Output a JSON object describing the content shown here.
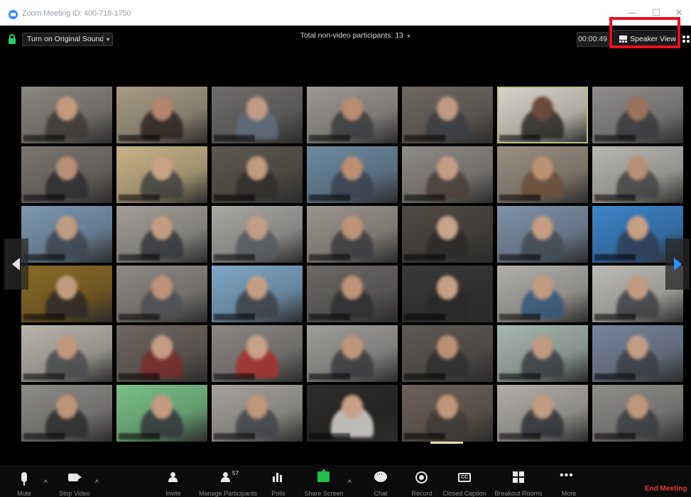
{
  "window": {
    "title": "Zoom Meeting ID: 400-718-1750",
    "min_glyph": "—",
    "max_glyph": "☐",
    "close_glyph": "✕"
  },
  "topbar": {
    "lock_icon": "lock-icon",
    "sound_button": "Turn on Original Sound",
    "sound_caret": "▾",
    "participants_note": "Total non-video participants: 13",
    "participants_caret": "▾",
    "timer": "00:00:49",
    "speaker_view": "Speaker View"
  },
  "colors": {
    "highlight": "#e8101e",
    "active_speaker_border": "#b8c27a",
    "share_green": "#1fbf4a",
    "end_meeting_red": "#e8363b",
    "next_page_arrow": "#2d8cff"
  },
  "gallery": {
    "columns": 7,
    "rows": 6,
    "active_tile": 5,
    "tiles": [
      {
        "bg": "#8a8680",
        "face": "#c49a7e",
        "shirt": "#3d3a37"
      },
      {
        "bg": "#a89b86",
        "face": "#b5856b",
        "shirt": "#2c2522"
      },
      {
        "bg": "#6e6d6b",
        "face": "#c19a84",
        "shirt": "#5f6e7d"
      },
      {
        "bg": "#9c9894",
        "face": "#b88d72",
        "shirt": "#3c3d40"
      },
      {
        "bg": "#6f6862",
        "face": "#c09982",
        "shirt": "#3b3e44"
      },
      {
        "bg": "#d9d4c8",
        "face": "#6a4a3a",
        "shirt": "#2c2a28"
      },
      {
        "bg": "#8f8d8b",
        "face": "#9b735c",
        "shirt": "#3a3a3d"
      },
      {
        "bg": "#7b7570",
        "face": "#b98f75",
        "shirt": "#2e2e30"
      },
      {
        "bg": "#c7b389",
        "face": "#c8a285",
        "shirt": "#40413f"
      },
      {
        "bg": "#5d5850",
        "face": "#c09a7e",
        "shirt": "#312f2d"
      },
      {
        "bg": "#6f8aa0",
        "face": "#b98e72",
        "shirt": "#3a4250"
      },
      {
        "bg": "#8e8a87",
        "face": "#c49c84",
        "shirt": "#4a3f3a"
      },
      {
        "bg": "#9a8f80",
        "face": "#bb9274",
        "shirt": "#6b4f3b"
      },
      {
        "bg": "#b9b7b2",
        "face": "#b88e74",
        "shirt": "#444446"
      },
      {
        "bg": "#7d97b0",
        "face": "#c09b80",
        "shirt": "#3f4552"
      },
      {
        "bg": "#a29f9a",
        "face": "#c39b80",
        "shirt": "#36383c"
      },
      {
        "bg": "#a9a7a4",
        "face": "#c29d85",
        "shirt": "#55595f"
      },
      {
        "bg": "#9b958e",
        "face": "#bd9375",
        "shirt": "#3a3b3e"
      },
      {
        "bg": "#4f4a44",
        "face": "#c6a489",
        "shirt": "#2c2b2a"
      },
      {
        "bg": "#7f92a8",
        "face": "#c49d82",
        "shirt": "#434a55"
      },
      {
        "bg": "#3f84c9",
        "face": "#c99f84",
        "shirt": "#2f3e55"
      },
      {
        "bg": "#8a6a28",
        "face": "#c19a7d",
        "shirt": "#2d2a26"
      },
      {
        "bg": "#8e8a86",
        "face": "#bd9278",
        "shirt": "#4d4f52"
      },
      {
        "bg": "#7fa7c6",
        "face": "#c49e84",
        "shirt": "#3e4145"
      },
      {
        "bg": "#6b6866",
        "face": "#bd9478",
        "shirt": "#2f3033"
      },
      {
        "bg": "#3b3a38",
        "face": "#c5a084",
        "shirt": "#2a2a2a"
      },
      {
        "bg": "#b1afab",
        "face": "#c09a7f",
        "shirt": "#34567a"
      },
      {
        "bg": "#bdbcb8",
        "face": "#c29b81",
        "shirt": "#3f4043"
      },
      {
        "bg": "#b9b5ad",
        "face": "#bf977b",
        "shirt": "#484a4d"
      },
      {
        "bg": "#6e6661",
        "face": "#c39c83",
        "shirt": "#7a2c2c"
      },
      {
        "bg": "#8a8784",
        "face": "#c7a188",
        "shirt": "#a8302c"
      },
      {
        "bg": "#9f9d9a",
        "face": "#bf9679",
        "shirt": "#393b3e"
      },
      {
        "bg": "#5e5a56",
        "face": "#bb9072",
        "shirt": "#2f2f30"
      },
      {
        "bg": "#a6b8b0",
        "face": "#c09a80",
        "shirt": "#3a3d40"
      },
      {
        "bg": "#77859a",
        "face": "#c29c83",
        "shirt": "#3c3e42"
      },
      {
        "bg": "#8d8b88",
        "face": "#bd9477",
        "shirt": "#2d2d2e"
      },
      {
        "bg": "#7bc089",
        "face": "#c39b7f",
        "shirt": "#33373a"
      },
      {
        "bg": "#a6a39e",
        "face": "#be967a",
        "shirt": "#42454a"
      },
      {
        "bg": "#2e2d2c",
        "face": "#c7a086",
        "shirt": "#d8d6d2"
      },
      {
        "bg": "#6e6258",
        "face": "#bf9679",
        "shirt": "#3d3a37"
      },
      {
        "bg": "#b1aea9",
        "face": "#c09b81",
        "shirt": "#2f3136"
      },
      {
        "bg": "#8f8d8a",
        "face": "#be967b",
        "shirt": "#3b3d40"
      }
    ]
  },
  "toolbar": {
    "mute": "Mute",
    "stop_video": "Stop Video",
    "invite": "Invite",
    "manage_participants": "Manage Participants",
    "participants_count": "57",
    "polls": "Polls",
    "share_screen": "Share Screen",
    "chat": "Chat",
    "record": "Record",
    "closed_caption": "Closed Caption",
    "cc_glyph": "CC",
    "breakout_rooms": "Breakout Rooms",
    "more": "More",
    "more_glyph": "•••",
    "caret": "^",
    "end_meeting": "End Meeting"
  }
}
